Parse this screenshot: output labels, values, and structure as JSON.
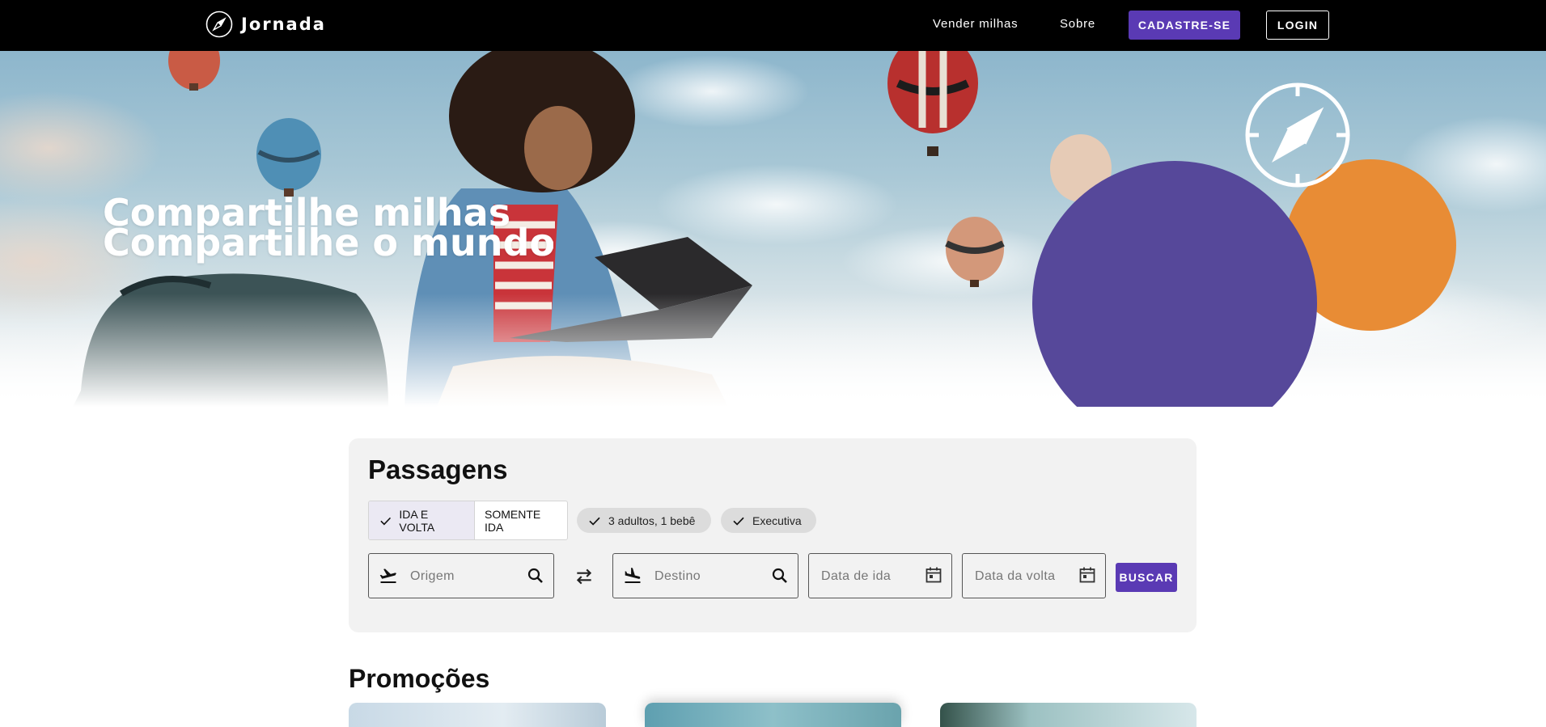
{
  "header": {
    "logo_text": "Jornada",
    "nav": {
      "sell_miles": "Vender milhas",
      "about": "Sobre"
    },
    "signup_label": "CADASTRE-SE",
    "login_label": "LOGIN"
  },
  "hero": {
    "title_line1": "Compartilhe milhas",
    "title_line2": "Compartilhe o mundo"
  },
  "search": {
    "title": "Passagens",
    "trip_type": {
      "round_trip": "IDA E VOLTA",
      "one_way": "SOMENTE IDA",
      "selected": "round_trip"
    },
    "passengers_chip": "3 adultos, 1 bebê",
    "class_chip": "Executiva",
    "origin_placeholder": "Origem",
    "destination_placeholder": "Destino",
    "depart_placeholder": "Data de ida",
    "return_placeholder": "Data da volta",
    "search_label": "BUSCAR"
  },
  "promotions": {
    "title": "Promoções"
  },
  "colors": {
    "brand_purple": "#5a3ab4",
    "circle_purple": "#56489a",
    "circle_orange": "#e88c35",
    "header_bg": "#000000"
  }
}
